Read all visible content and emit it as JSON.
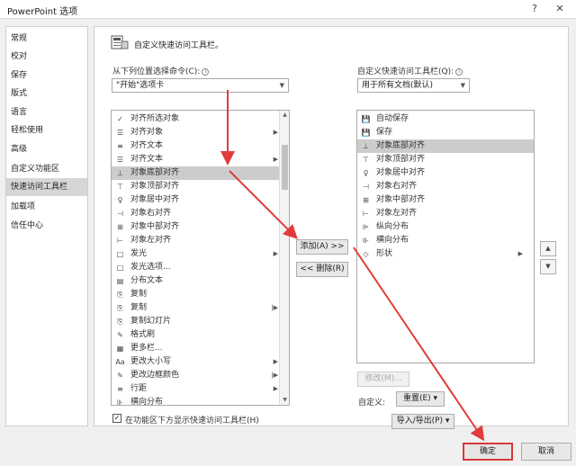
{
  "window": {
    "title": "PowerPoint 选项",
    "help": "?",
    "close": "✕"
  },
  "nav": {
    "items": [
      {
        "label": "常规"
      },
      {
        "label": "校对"
      },
      {
        "label": "保存"
      },
      {
        "label": "版式"
      },
      {
        "label": "语言"
      },
      {
        "label": "轻松使用"
      },
      {
        "label": "高级"
      },
      {
        "label": "自定义功能区"
      },
      {
        "label": "快速访问工具栏"
      },
      {
        "label": "加载项"
      },
      {
        "label": "信任中心"
      }
    ]
  },
  "main": {
    "title": "自定义快速访问工具栏。",
    "left_label": "从下列位置选择命令(C):",
    "left_combo": "\"开始\"选项卡",
    "right_label": "自定义快速访问工具栏(Q):",
    "right_combo": "用于所有文档(默认)",
    "left_list": [
      {
        "icon": "✓",
        "label": "对齐所选对象",
        "sub": ""
      },
      {
        "icon": "☰",
        "label": "对齐对象",
        "sub": "▶"
      },
      {
        "icon": "≡",
        "label": "对齐文本",
        "sub": ""
      },
      {
        "icon": "☰",
        "label": "对齐文本",
        "sub": "▶"
      },
      {
        "icon": "⊥",
        "label": "对象底部对齐",
        "sub": ""
      },
      {
        "icon": "⊤",
        "label": "对象顶部对齐",
        "sub": ""
      },
      {
        "icon": "♀",
        "label": "对象居中对齐",
        "sub": ""
      },
      {
        "icon": "⊣",
        "label": "对象右对齐",
        "sub": ""
      },
      {
        "icon": "⊞",
        "label": "对象中部对齐",
        "sub": ""
      },
      {
        "icon": "⊢",
        "label": "对象左对齐",
        "sub": ""
      },
      {
        "icon": "□",
        "label": "发光",
        "sub": "▶"
      },
      {
        "icon": "□",
        "label": "发光选项...",
        "sub": ""
      },
      {
        "icon": "▤",
        "label": "分布文本",
        "sub": ""
      },
      {
        "icon": "⎘",
        "label": "复制",
        "sub": ""
      },
      {
        "icon": "⎘",
        "label": "复制",
        "sub": "|▶"
      },
      {
        "icon": "⎘",
        "label": "复制幻灯片",
        "sub": ""
      },
      {
        "icon": "✎",
        "label": "格式刷",
        "sub": ""
      },
      {
        "icon": "▦",
        "label": "更多栏...",
        "sub": ""
      },
      {
        "icon": "Aa",
        "label": "更改大小写",
        "sub": "▶"
      },
      {
        "icon": "✎",
        "label": "更改边框颜色",
        "sub": "|▶"
      },
      {
        "icon": "≡",
        "label": "行距",
        "sub": "▶"
      },
      {
        "icon": "⊪",
        "label": "横向分布",
        "sub": ""
      }
    ],
    "left_selected_index": 4,
    "right_list": [
      {
        "icon": "💾",
        "label": "自动保存",
        "sub": ""
      },
      {
        "icon": "💾",
        "label": "保存",
        "sub": ""
      },
      {
        "icon": "⊥",
        "label": "对象底部对齐",
        "sub": ""
      },
      {
        "icon": "⊤",
        "label": "对象顶部对齐",
        "sub": ""
      },
      {
        "icon": "♀",
        "label": "对象居中对齐",
        "sub": ""
      },
      {
        "icon": "⊣",
        "label": "对象右对齐",
        "sub": ""
      },
      {
        "icon": "⊞",
        "label": "对象中部对齐",
        "sub": ""
      },
      {
        "icon": "⊢",
        "label": "对象左对齐",
        "sub": ""
      },
      {
        "icon": "⊫",
        "label": "纵向分布",
        "sub": ""
      },
      {
        "icon": "⊪",
        "label": "横向分布",
        "sub": ""
      },
      {
        "icon": "◇",
        "label": "形状",
        "sub": "▶"
      }
    ],
    "right_selected_index": 2,
    "add_button": "添加(A) >>",
    "remove_button": "<< 删除(R)",
    "modify_button": "修改(M)...",
    "customize_label": "自定义:",
    "reset_button": "重置(E) ▾",
    "import_export_button": "导入/导出(P) ▾",
    "show_below_checkbox": "在功能区下方显示快速访问工具栏(H)",
    "show_below_checked": true,
    "move_up": "▲",
    "move_down": "▼"
  },
  "footer": {
    "ok": "确定",
    "cancel": "取消"
  },
  "colors": {
    "annotation_red": "#e23b3b"
  }
}
